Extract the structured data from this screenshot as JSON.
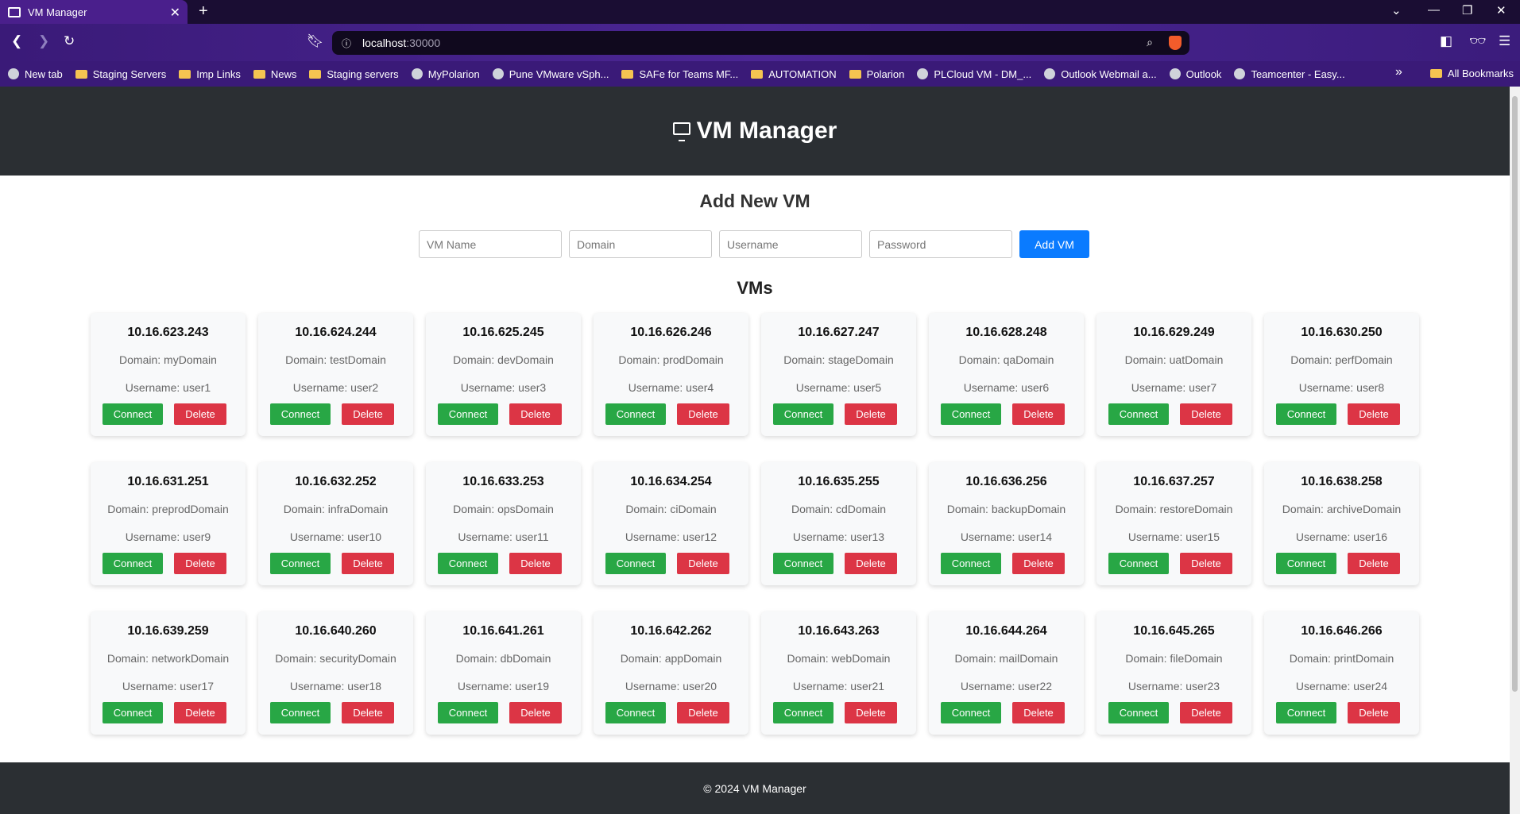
{
  "browser": {
    "tab_title": "VM Manager",
    "url_host": "localhost",
    "url_port": ":30000",
    "bookmarks": [
      {
        "label": "New tab",
        "icon": "globe-icon"
      },
      {
        "label": "Staging Servers",
        "icon": "folder-icon"
      },
      {
        "label": "Imp Links",
        "icon": "folder-icon"
      },
      {
        "label": "News",
        "icon": "folder-icon"
      },
      {
        "label": "Staging servers",
        "icon": "folder-icon"
      },
      {
        "label": "MyPolarion",
        "icon": "polarion-icon"
      },
      {
        "label": "Pune VMware vSph...",
        "icon": "globe-icon"
      },
      {
        "label": "SAFe for Teams MF...",
        "icon": "folder-icon"
      },
      {
        "label": "AUTOMATION",
        "icon": "folder-icon"
      },
      {
        "label": "Polarion",
        "icon": "folder-icon"
      },
      {
        "label": "PLCloud VM - DM_...",
        "icon": "site-icon"
      },
      {
        "label": "Outlook Webmail a...",
        "icon": "outlook-icon"
      },
      {
        "label": "Outlook",
        "icon": "microsoft-icon"
      },
      {
        "label": "Teamcenter - Easy...",
        "icon": "site-icon"
      }
    ],
    "all_bookmarks": "All Bookmarks"
  },
  "header": {
    "title": "VM Manager",
    "icon": "monitor-icon"
  },
  "form": {
    "title": "Add New VM",
    "vm_name_placeholder": "VM Name",
    "domain_placeholder": "Domain",
    "username_placeholder": "Username",
    "password_placeholder": "Password",
    "submit_label": "Add VM"
  },
  "vms_title": "VMs",
  "connect_label": "Connect",
  "delete_label": "Delete",
  "vms": [
    {
      "ip": "10.16.623.243",
      "domain": "Domain: myDomain",
      "username": "Username: user1"
    },
    {
      "ip": "10.16.624.244",
      "domain": "Domain: testDomain",
      "username": "Username: user2"
    },
    {
      "ip": "10.16.625.245",
      "domain": "Domain: devDomain",
      "username": "Username: user3"
    },
    {
      "ip": "10.16.626.246",
      "domain": "Domain: prodDomain",
      "username": "Username: user4"
    },
    {
      "ip": "10.16.627.247",
      "domain": "Domain: stageDomain",
      "username": "Username: user5"
    },
    {
      "ip": "10.16.628.248",
      "domain": "Domain: qaDomain",
      "username": "Username: user6"
    },
    {
      "ip": "10.16.629.249",
      "domain": "Domain: uatDomain",
      "username": "Username: user7"
    },
    {
      "ip": "10.16.630.250",
      "domain": "Domain: perfDomain",
      "username": "Username: user8"
    },
    {
      "ip": "10.16.631.251",
      "domain": "Domain: preprodDomain",
      "username": "Username: user9"
    },
    {
      "ip": "10.16.632.252",
      "domain": "Domain: infraDomain",
      "username": "Username: user10"
    },
    {
      "ip": "10.16.633.253",
      "domain": "Domain: opsDomain",
      "username": "Username: user11"
    },
    {
      "ip": "10.16.634.254",
      "domain": "Domain: ciDomain",
      "username": "Username: user12"
    },
    {
      "ip": "10.16.635.255",
      "domain": "Domain: cdDomain",
      "username": "Username: user13"
    },
    {
      "ip": "10.16.636.256",
      "domain": "Domain: backupDomain",
      "username": "Username: user14"
    },
    {
      "ip": "10.16.637.257",
      "domain": "Domain: restoreDomain",
      "username": "Username: user15"
    },
    {
      "ip": "10.16.638.258",
      "domain": "Domain: archiveDomain",
      "username": "Username: user16"
    },
    {
      "ip": "10.16.639.259",
      "domain": "Domain: networkDomain",
      "username": "Username: user17"
    },
    {
      "ip": "10.16.640.260",
      "domain": "Domain: securityDomain",
      "username": "Username: user18"
    },
    {
      "ip": "10.16.641.261",
      "domain": "Domain: dbDomain",
      "username": "Username: user19"
    },
    {
      "ip": "10.16.642.262",
      "domain": "Domain: appDomain",
      "username": "Username: user20"
    },
    {
      "ip": "10.16.643.263",
      "domain": "Domain: webDomain",
      "username": "Username: user21"
    },
    {
      "ip": "10.16.644.264",
      "domain": "Domain: mailDomain",
      "username": "Username: user22"
    },
    {
      "ip": "10.16.645.265",
      "domain": "Domain: fileDomain",
      "username": "Username: user23"
    },
    {
      "ip": "10.16.646.266",
      "domain": "Domain: printDomain",
      "username": "Username: user24"
    }
  ],
  "footer": {
    "text": "© 2024 VM Manager"
  },
  "colors": {
    "header_bg": "#2b2f33",
    "primary": "#0a7bff",
    "connect": "#28a745",
    "delete": "#dc3545",
    "browser_chrome": "#3a1a78"
  }
}
